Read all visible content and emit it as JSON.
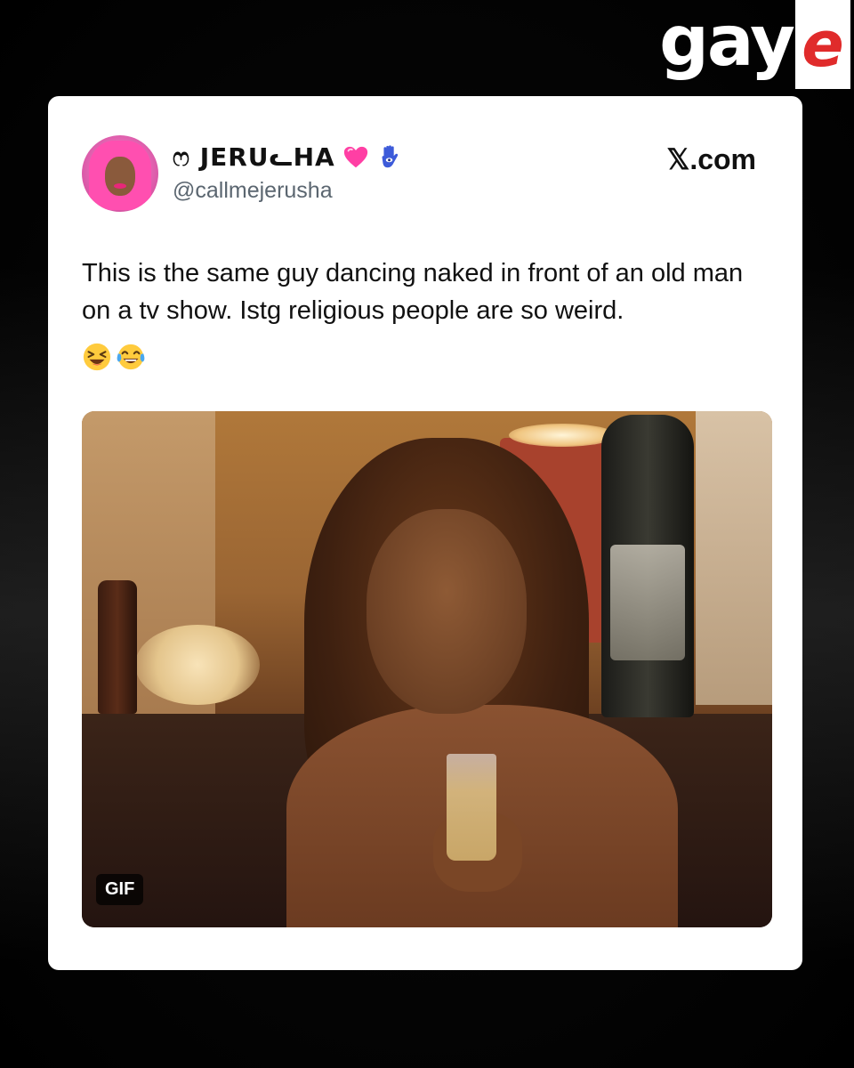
{
  "brand": {
    "text": "gay",
    "accent_letter": "e",
    "accent_color": "#e02b2b"
  },
  "tweet": {
    "display_name": "ෆ JERUᓚHA",
    "name_icons": [
      "pink-heart-icon",
      "hamsa-icon"
    ],
    "handle": "@callmejerusha",
    "source": "𝕏.com",
    "text": "This is the same guy dancing naked in front of an old man on a tv show. Istg religious people are so weird.",
    "emojis": [
      "laughing-squint-icon",
      "tears-of-joy-icon"
    ],
    "media": {
      "badge": "GIF"
    }
  }
}
